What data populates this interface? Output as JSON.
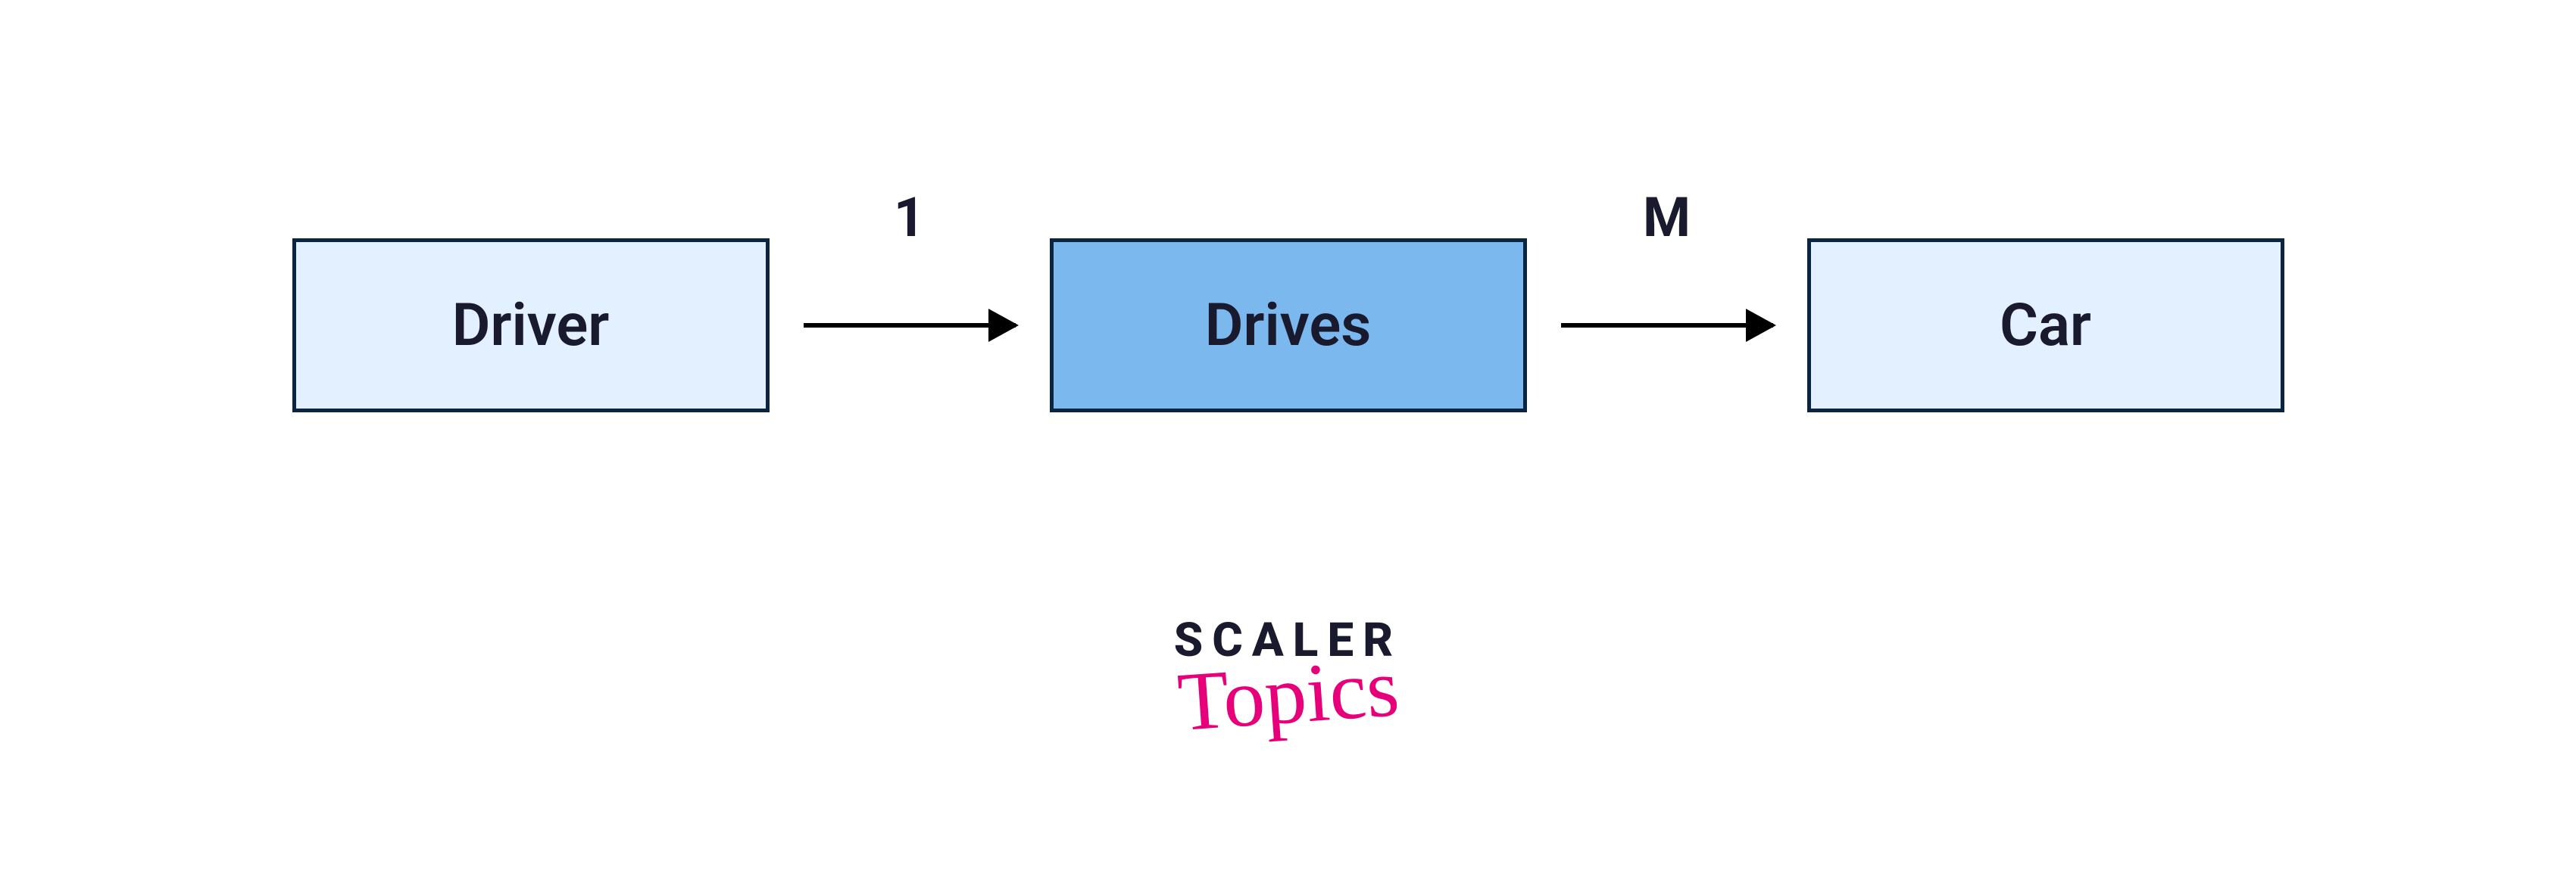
{
  "diagram": {
    "entities": [
      {
        "label": "Driver",
        "style": "light"
      },
      {
        "label": "Drives",
        "style": "mid"
      },
      {
        "label": "Car",
        "style": "light"
      }
    ],
    "arrows": [
      {
        "cardinality": "1"
      },
      {
        "cardinality": "M"
      }
    ]
  },
  "logo": {
    "line1": "SCALER",
    "line2": "Topics"
  }
}
